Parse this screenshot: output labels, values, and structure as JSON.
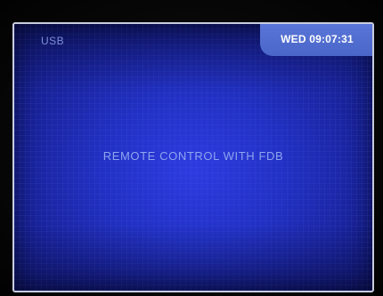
{
  "screen": {
    "top_left_label": "USB",
    "clock": "WED 09:07:31",
    "message": "REMOTE CONTROL WITH FDB"
  },
  "colors": {
    "screen_blue": "#2231c4",
    "clock_tab": "#5a76d8",
    "message_text": "#8fa4ee",
    "label_text": "#7d8fd8"
  }
}
